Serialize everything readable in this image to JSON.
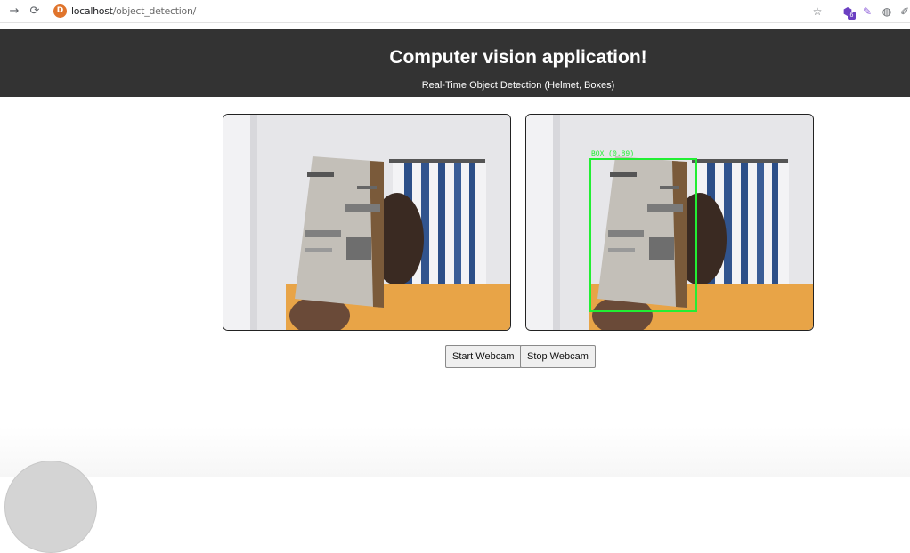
{
  "browser": {
    "back": "→",
    "reload": "⟳",
    "favicon_letter": "D",
    "url_host": "localhost",
    "url_path": "/object_detection/",
    "extension_badge": "6"
  },
  "header": {
    "title": "Computer vision application!",
    "subtitle": "Real-Time Object Detection (Helmet, Boxes)"
  },
  "feeds": {
    "raw_feed": "webcam-feed",
    "detection_feed": "detection-feed",
    "detection_label": "BOX (0.89)",
    "box_color": "#22ee33"
  },
  "controls": {
    "start_label": "Start Webcam",
    "stop_label": "Stop Webcam"
  }
}
